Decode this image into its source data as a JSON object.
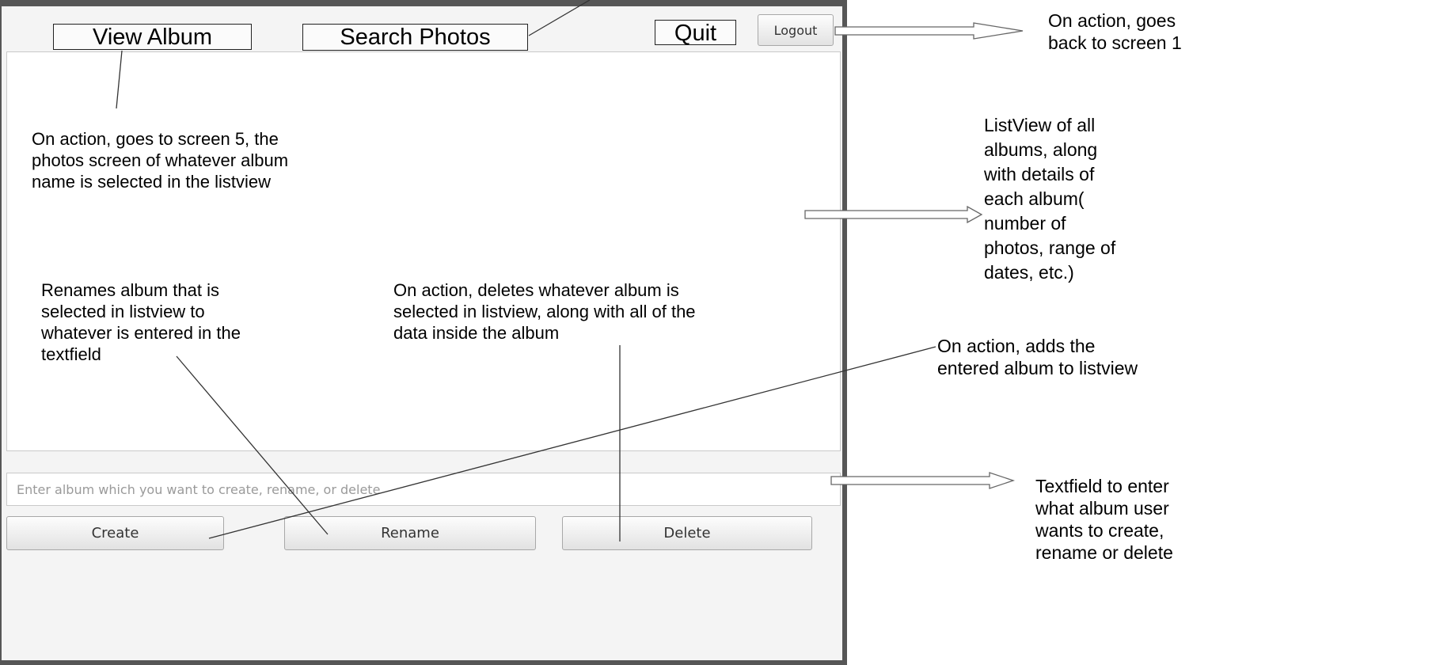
{
  "window": {
    "view_album_label": "View Album",
    "search_photos_label": "Search Photos",
    "quit_label": "Quit",
    "logout_label": "Logout",
    "textfield_placeholder": "Enter album which you want to create, rename, or delete",
    "create_label": "Create",
    "rename_label": "Rename",
    "delete_label": "Delete"
  },
  "annotations": {
    "view_album_note": [
      "On action, goes to screen 5, the",
      "photos screen of whatever album",
      "name is selected in the listview"
    ],
    "rename_note": [
      "Renames album that is",
      "selected in listview to",
      "whatever is entered in the",
      "textfield"
    ],
    "delete_note": [
      "On action, deletes whatever album is",
      "selected in listview, along with all of the",
      "data inside the album"
    ],
    "logout_note": [
      "On action, goes",
      "back to screen 1"
    ],
    "listview_note": [
      "ListView of all",
      "albums, along",
      "with details of",
      "each album(",
      "number of",
      "photos, range of",
      "dates, etc.)"
    ],
    "create_note": [
      "On action, adds the",
      "entered album to listview"
    ],
    "textfield_note": [
      "Textfield to enter",
      "what album user",
      "wants to create,",
      "rename or delete"
    ]
  }
}
